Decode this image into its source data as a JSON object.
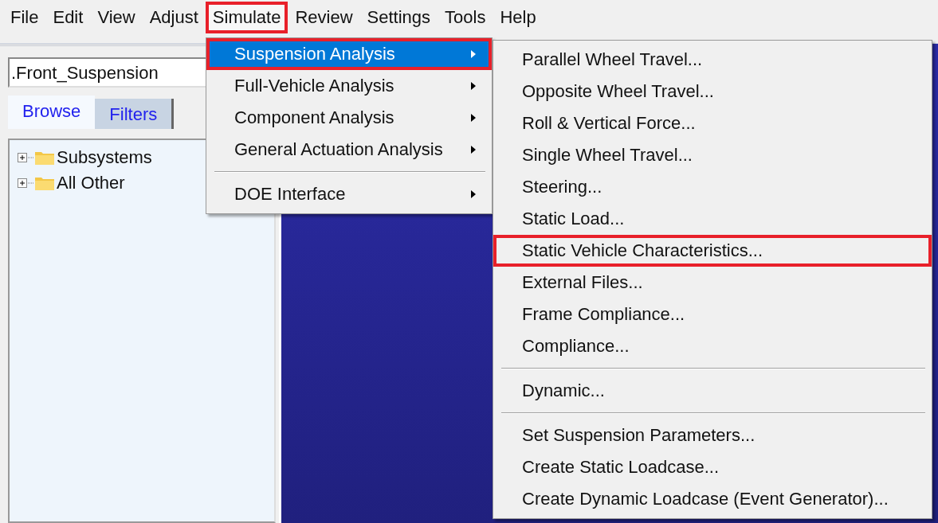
{
  "menu_bar": [
    {
      "label": "File",
      "highlighted": false
    },
    {
      "label": "Edit",
      "highlighted": false
    },
    {
      "label": "View",
      "highlighted": false
    },
    {
      "label": "Adjust",
      "highlighted": false
    },
    {
      "label": "Simulate",
      "highlighted": true
    },
    {
      "label": "Review",
      "highlighted": false
    },
    {
      "label": "Settings",
      "highlighted": false
    },
    {
      "label": "Tools",
      "highlighted": false
    },
    {
      "label": "Help",
      "highlighted": false
    }
  ],
  "object_field": {
    "value": ".Front_Suspension"
  },
  "tabs": [
    {
      "label": "Browse",
      "selected": true
    },
    {
      "label": "Filters",
      "selected": false
    }
  ],
  "tree": [
    {
      "label": "Subsystems",
      "expanded": false
    },
    {
      "label": "All Other",
      "expanded": false
    }
  ],
  "simulate_menu": [
    {
      "kind": "item",
      "label": "Suspension Analysis",
      "submenu": true,
      "selected": true,
      "highlighted": true
    },
    {
      "kind": "item",
      "label": "Full-Vehicle Analysis",
      "submenu": true,
      "selected": false,
      "highlighted": false
    },
    {
      "kind": "item",
      "label": "Component Analysis",
      "submenu": true,
      "selected": false,
      "highlighted": false
    },
    {
      "kind": "item",
      "label": "General Actuation Analysis",
      "submenu": true,
      "selected": false,
      "highlighted": false
    },
    {
      "kind": "separator"
    },
    {
      "kind": "item",
      "label": "DOE Interface",
      "submenu": true,
      "selected": false,
      "highlighted": false
    }
  ],
  "suspension_submenu": [
    {
      "kind": "item",
      "label": "Parallel Wheel Travel...",
      "selected": false,
      "highlighted": false
    },
    {
      "kind": "item",
      "label": "Opposite Wheel Travel...",
      "selected": false,
      "highlighted": false
    },
    {
      "kind": "item",
      "label": "Roll & Vertical Force...",
      "selected": false,
      "highlighted": false
    },
    {
      "kind": "item",
      "label": "Single Wheel Travel...",
      "selected": false,
      "highlighted": false
    },
    {
      "kind": "item",
      "label": "Steering...",
      "selected": false,
      "highlighted": false
    },
    {
      "kind": "item",
      "label": "Static Load...",
      "selected": false,
      "highlighted": false
    },
    {
      "kind": "item",
      "label": "Static Vehicle Characteristics...",
      "selected": false,
      "highlighted": true
    },
    {
      "kind": "item",
      "label": "External Files...",
      "selected": false,
      "highlighted": false
    },
    {
      "kind": "item",
      "label": "Frame Compliance...",
      "selected": false,
      "highlighted": false
    },
    {
      "kind": "item",
      "label": "Compliance...",
      "selected": false,
      "highlighted": false
    },
    {
      "kind": "separator"
    },
    {
      "kind": "item",
      "label": "Dynamic...",
      "selected": false,
      "highlighted": false
    },
    {
      "kind": "separator"
    },
    {
      "kind": "item",
      "label": "Set Suspension Parameters...",
      "selected": false,
      "highlighted": false
    },
    {
      "kind": "item",
      "label": "Create Static Loadcase...",
      "selected": false,
      "highlighted": false
    },
    {
      "kind": "item",
      "label": "Create Dynamic Loadcase (Event Generator)...",
      "selected": false,
      "highlighted": false
    }
  ]
}
